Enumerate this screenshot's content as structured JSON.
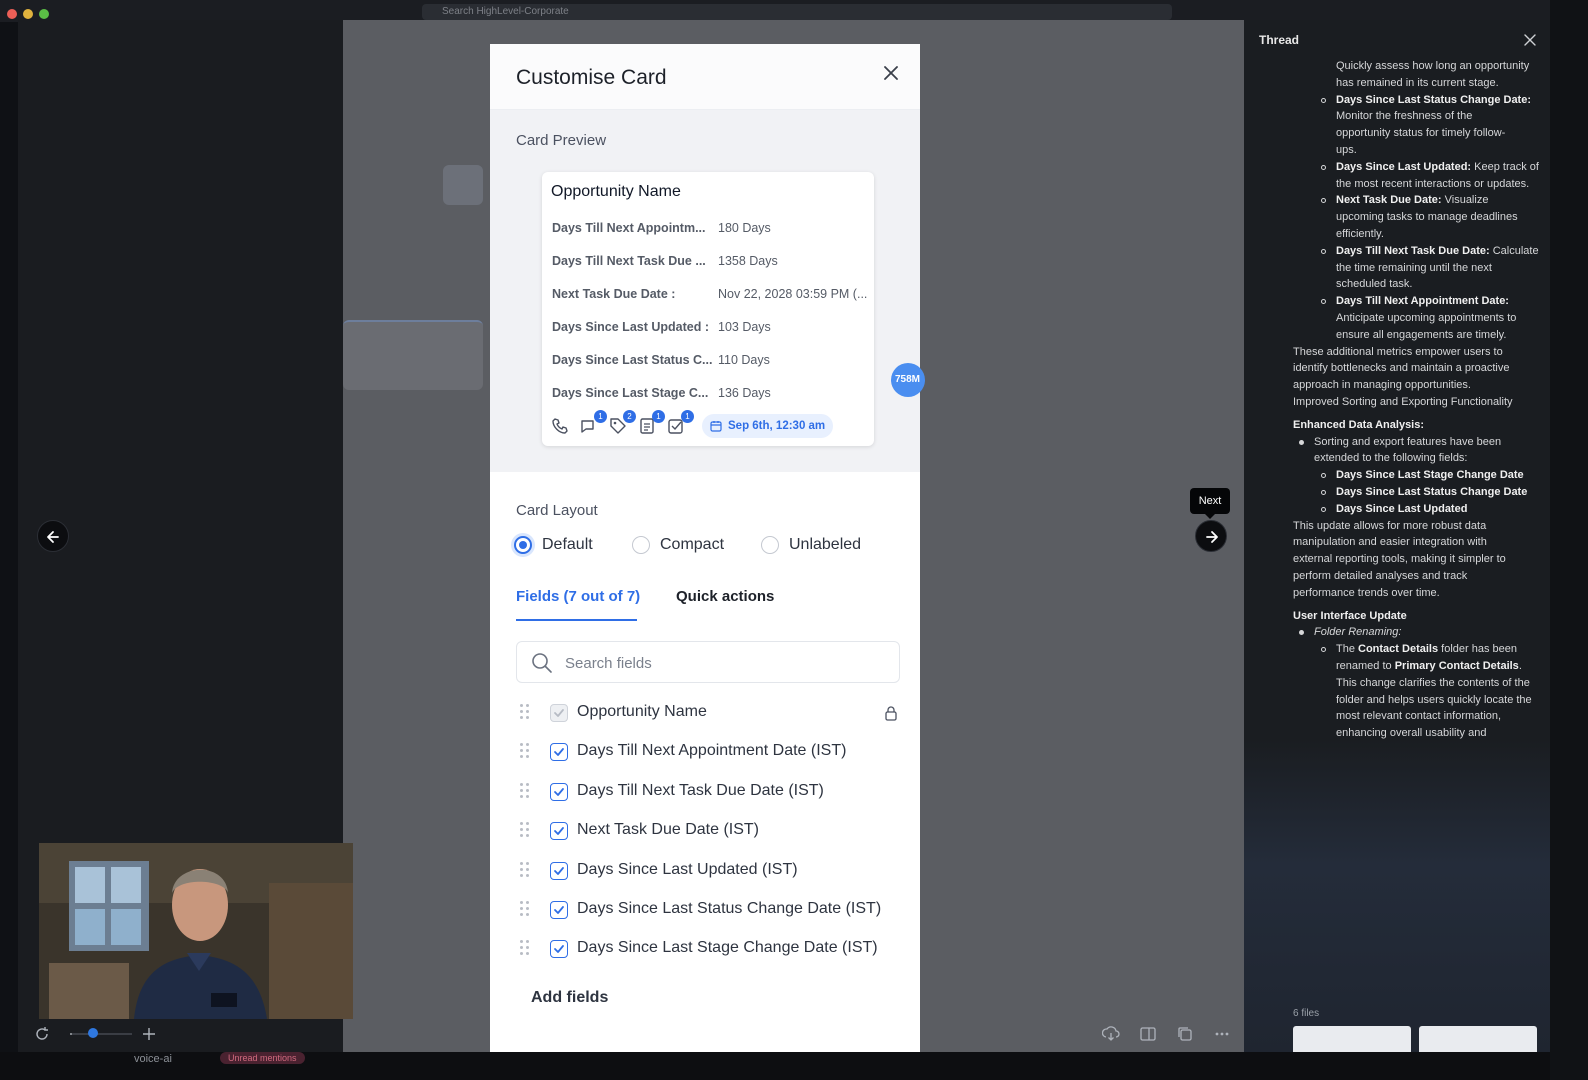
{
  "browser": {
    "url_placeholder": "Search HighLevel-Corporate"
  },
  "modal": {
    "title": "Customise Card",
    "preview_label": "Card Preview",
    "card": {
      "title": "Opportunity Name",
      "rows": [
        {
          "key": "Days Till Next Appointm...",
          "value": "180 Days"
        },
        {
          "key": "Days Till Next Task Due ...",
          "value": "1358 Days"
        },
        {
          "key": "Next Task Due Date :",
          "value": "Nov 22, 2028 03:59 PM (..."
        },
        {
          "key": "Days Since Last Updated :",
          "value": "103 Days"
        },
        {
          "key": "Days Since Last Status C...",
          "value": "110 Days"
        },
        {
          "key": "Days Since Last Stage C...",
          "value": "136 Days"
        }
      ],
      "icons": [
        {
          "name": "phone-icon",
          "badge": ""
        },
        {
          "name": "chat-icon",
          "badge": "1"
        },
        {
          "name": "tag-icon",
          "badge": "2"
        },
        {
          "name": "note-icon",
          "badge": "1"
        },
        {
          "name": "task-icon",
          "badge": "1"
        }
      ],
      "date_pill": "Sep 6th, 12:30 am"
    },
    "side_badge": "758M",
    "layout_label": "Card Layout",
    "layout_options": [
      "Default",
      "Compact",
      "Unlabeled"
    ],
    "layout_selected": "Default",
    "tabs": [
      "Fields (7 out of 7)",
      "Quick actions"
    ],
    "active_tab": "Fields (7 out of 7)",
    "search_placeholder": "Search fields",
    "fields": [
      {
        "label": "Opportunity Name",
        "checked": true,
        "locked": true
      },
      {
        "label": "Days Till Next Appointment Date (IST)",
        "checked": true,
        "locked": false
      },
      {
        "label": "Days Till Next Task Due Date (IST)",
        "checked": true,
        "locked": false
      },
      {
        "label": "Next Task Due Date (IST)",
        "checked": true,
        "locked": false
      },
      {
        "label": "Days Since Last Updated (IST)",
        "checked": true,
        "locked": false
      },
      {
        "label": "Days Since Last Status Change Date (IST)",
        "checked": true,
        "locked": false
      },
      {
        "label": "Days Since Last Stage Change Date (IST)",
        "checked": true,
        "locked": false
      }
    ],
    "add_fields": "Add fields"
  },
  "viewer": {
    "next_tooltip": "Next"
  },
  "bottom": {
    "channel": "voice-ai",
    "mentions": "Unread mentions"
  },
  "thread": {
    "title": "Thread",
    "lines": [
      {
        "indent": 2,
        "bullet": "",
        "bold": "",
        "text": "Quickly assess how long an opportunity"
      },
      {
        "indent": 2,
        "bullet": "",
        "bold": "",
        "text": "has remained in its current stage."
      },
      {
        "indent": 2,
        "bullet": "ring",
        "bold": "Days Since Last Status Change Date:",
        "text": ""
      },
      {
        "indent": 2,
        "bullet": "",
        "bold": "",
        "text": "Monitor the freshness of the"
      },
      {
        "indent": 2,
        "bullet": "",
        "bold": "",
        "text": "opportunity status for timely follow-"
      },
      {
        "indent": 2,
        "bullet": "",
        "bold": "",
        "text": "ups."
      },
      {
        "indent": 2,
        "bullet": "ring",
        "bold": "Days Since Last Updated:",
        "text": " Keep track of"
      },
      {
        "indent": 2,
        "bullet": "",
        "bold": "",
        "text": "the most recent interactions or updates."
      },
      {
        "indent": 2,
        "bullet": "ring",
        "bold": "Next Task Due Date:",
        "text": " Visualize"
      },
      {
        "indent": 2,
        "bullet": "",
        "bold": "",
        "text": "upcoming tasks to manage deadlines"
      },
      {
        "indent": 2,
        "bullet": "",
        "bold": "",
        "text": "efficiently."
      },
      {
        "indent": 2,
        "bullet": "ring",
        "bold": "Days Till Next Task Due Date:",
        "text": " Calculate"
      },
      {
        "indent": 2,
        "bullet": "",
        "bold": "",
        "text": "the time remaining until the next"
      },
      {
        "indent": 2,
        "bullet": "",
        "bold": "",
        "text": "scheduled task."
      },
      {
        "indent": 2,
        "bullet": "ring",
        "bold": "Days Till Next Appointment Date:",
        "text": ""
      },
      {
        "indent": 2,
        "bullet": "",
        "bold": "",
        "text": "Anticipate upcoming appointments to"
      },
      {
        "indent": 2,
        "bullet": "",
        "bold": "",
        "text": "ensure all engagements are timely."
      },
      {
        "indent": 0,
        "bullet": "",
        "bold": "",
        "text": "These additional metrics empower users to"
      },
      {
        "indent": 0,
        "bullet": "",
        "bold": "",
        "text": "identify bottlenecks and maintain a proactive"
      },
      {
        "indent": 0,
        "bullet": "",
        "bold": "",
        "text": "approach in managing opportunities."
      },
      {
        "indent": 0,
        "bullet": "",
        "bold": "",
        "text": "Improved Sorting and Exporting Functionality"
      },
      {
        "indent": 0,
        "bullet": "gap",
        "bold": "Enhanced Data Analysis:",
        "text": ""
      },
      {
        "indent": 1,
        "bullet": "fill",
        "bold": "",
        "text": "Sorting and export features have been"
      },
      {
        "indent": 1,
        "bullet": "",
        "bold": "",
        "text": "extended to the following fields:"
      },
      {
        "indent": 2,
        "bullet": "ring",
        "bold": "Days Since Last Stage Change Date",
        "text": ""
      },
      {
        "indent": 2,
        "bullet": "ring",
        "bold": "Days Since Last Status Change Date",
        "text": ""
      },
      {
        "indent": 2,
        "bullet": "ring",
        "bold": "Days Since Last Updated",
        "text": ""
      },
      {
        "indent": 0,
        "bullet": "",
        "bold": "",
        "text": "This update allows for more robust data"
      },
      {
        "indent": 0,
        "bullet": "",
        "bold": "",
        "text": "manipulation and easier integration with"
      },
      {
        "indent": 0,
        "bullet": "",
        "bold": "",
        "text": "external reporting tools, making it simpler to"
      },
      {
        "indent": 0,
        "bullet": "",
        "bold": "",
        "text": "perform detailed analyses and track"
      },
      {
        "indent": 0,
        "bullet": "",
        "bold": "",
        "text": "performance trends over time."
      },
      {
        "indent": 0,
        "bullet": "gap",
        "bold": "User Interface Update",
        "text": ""
      },
      {
        "indent": 1,
        "bullet": "fill",
        "bold": "",
        "text": "",
        "italic": "Folder Renaming:"
      },
      {
        "indent": 2,
        "bullet": "ring",
        "bold": "",
        "text": "The ",
        "bold2": "Contact Details",
        "text2": " folder has been"
      },
      {
        "indent": 2,
        "bullet": "",
        "bold": "",
        "text": "renamed to ",
        "bold2": "Primary Contact Details",
        "text2": "."
      },
      {
        "indent": 2,
        "bullet": "",
        "bold": "",
        "text": "This change clarifies the contents of the"
      },
      {
        "indent": 2,
        "bullet": "",
        "bold": "",
        "text": "folder and helps users quickly locate the"
      },
      {
        "indent": 2,
        "bullet": "",
        "bold": "",
        "text": "most relevant contact information,"
      },
      {
        "indent": 2,
        "bullet": "",
        "bold": "",
        "text": "enhancing overall usability and"
      }
    ],
    "files_label": "6 files"
  }
}
